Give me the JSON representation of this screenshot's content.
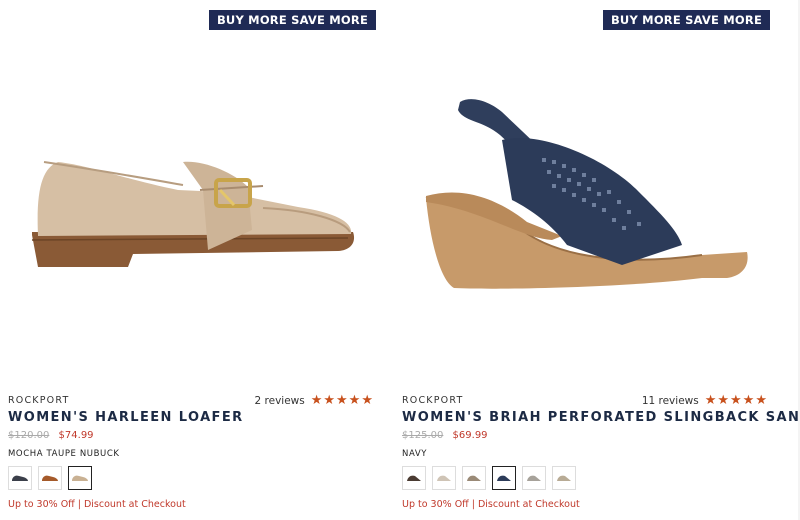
{
  "products": [
    {
      "badge": "BUY MORE SAVE MORE",
      "brand": "ROCKPORT",
      "reviews": "2 reviews",
      "stars": "★★★★★",
      "title": "WOMEN'S HARLEEN LOAFER",
      "original_price": "$120.00",
      "sale_price": "$74.99",
      "color_name": "MOCHA TAUPE NUBUCK",
      "promo": "Up to 30% Off | Discount at Checkout",
      "accent": "#1f2a55"
    },
    {
      "badge": "BUY MORE SAVE MORE",
      "brand": "ROCKPORT",
      "reviews": "11 reviews",
      "stars": "★★★★★",
      "title": "WOMEN'S BRIAH PERFORATED SLINGBACK SANDAL",
      "original_price": "$125.00",
      "sale_price": "$69.99",
      "color_name": "NAVY",
      "promo": "Up to 30% Off | Discount at Checkout",
      "accent": "#1f2a55"
    }
  ]
}
